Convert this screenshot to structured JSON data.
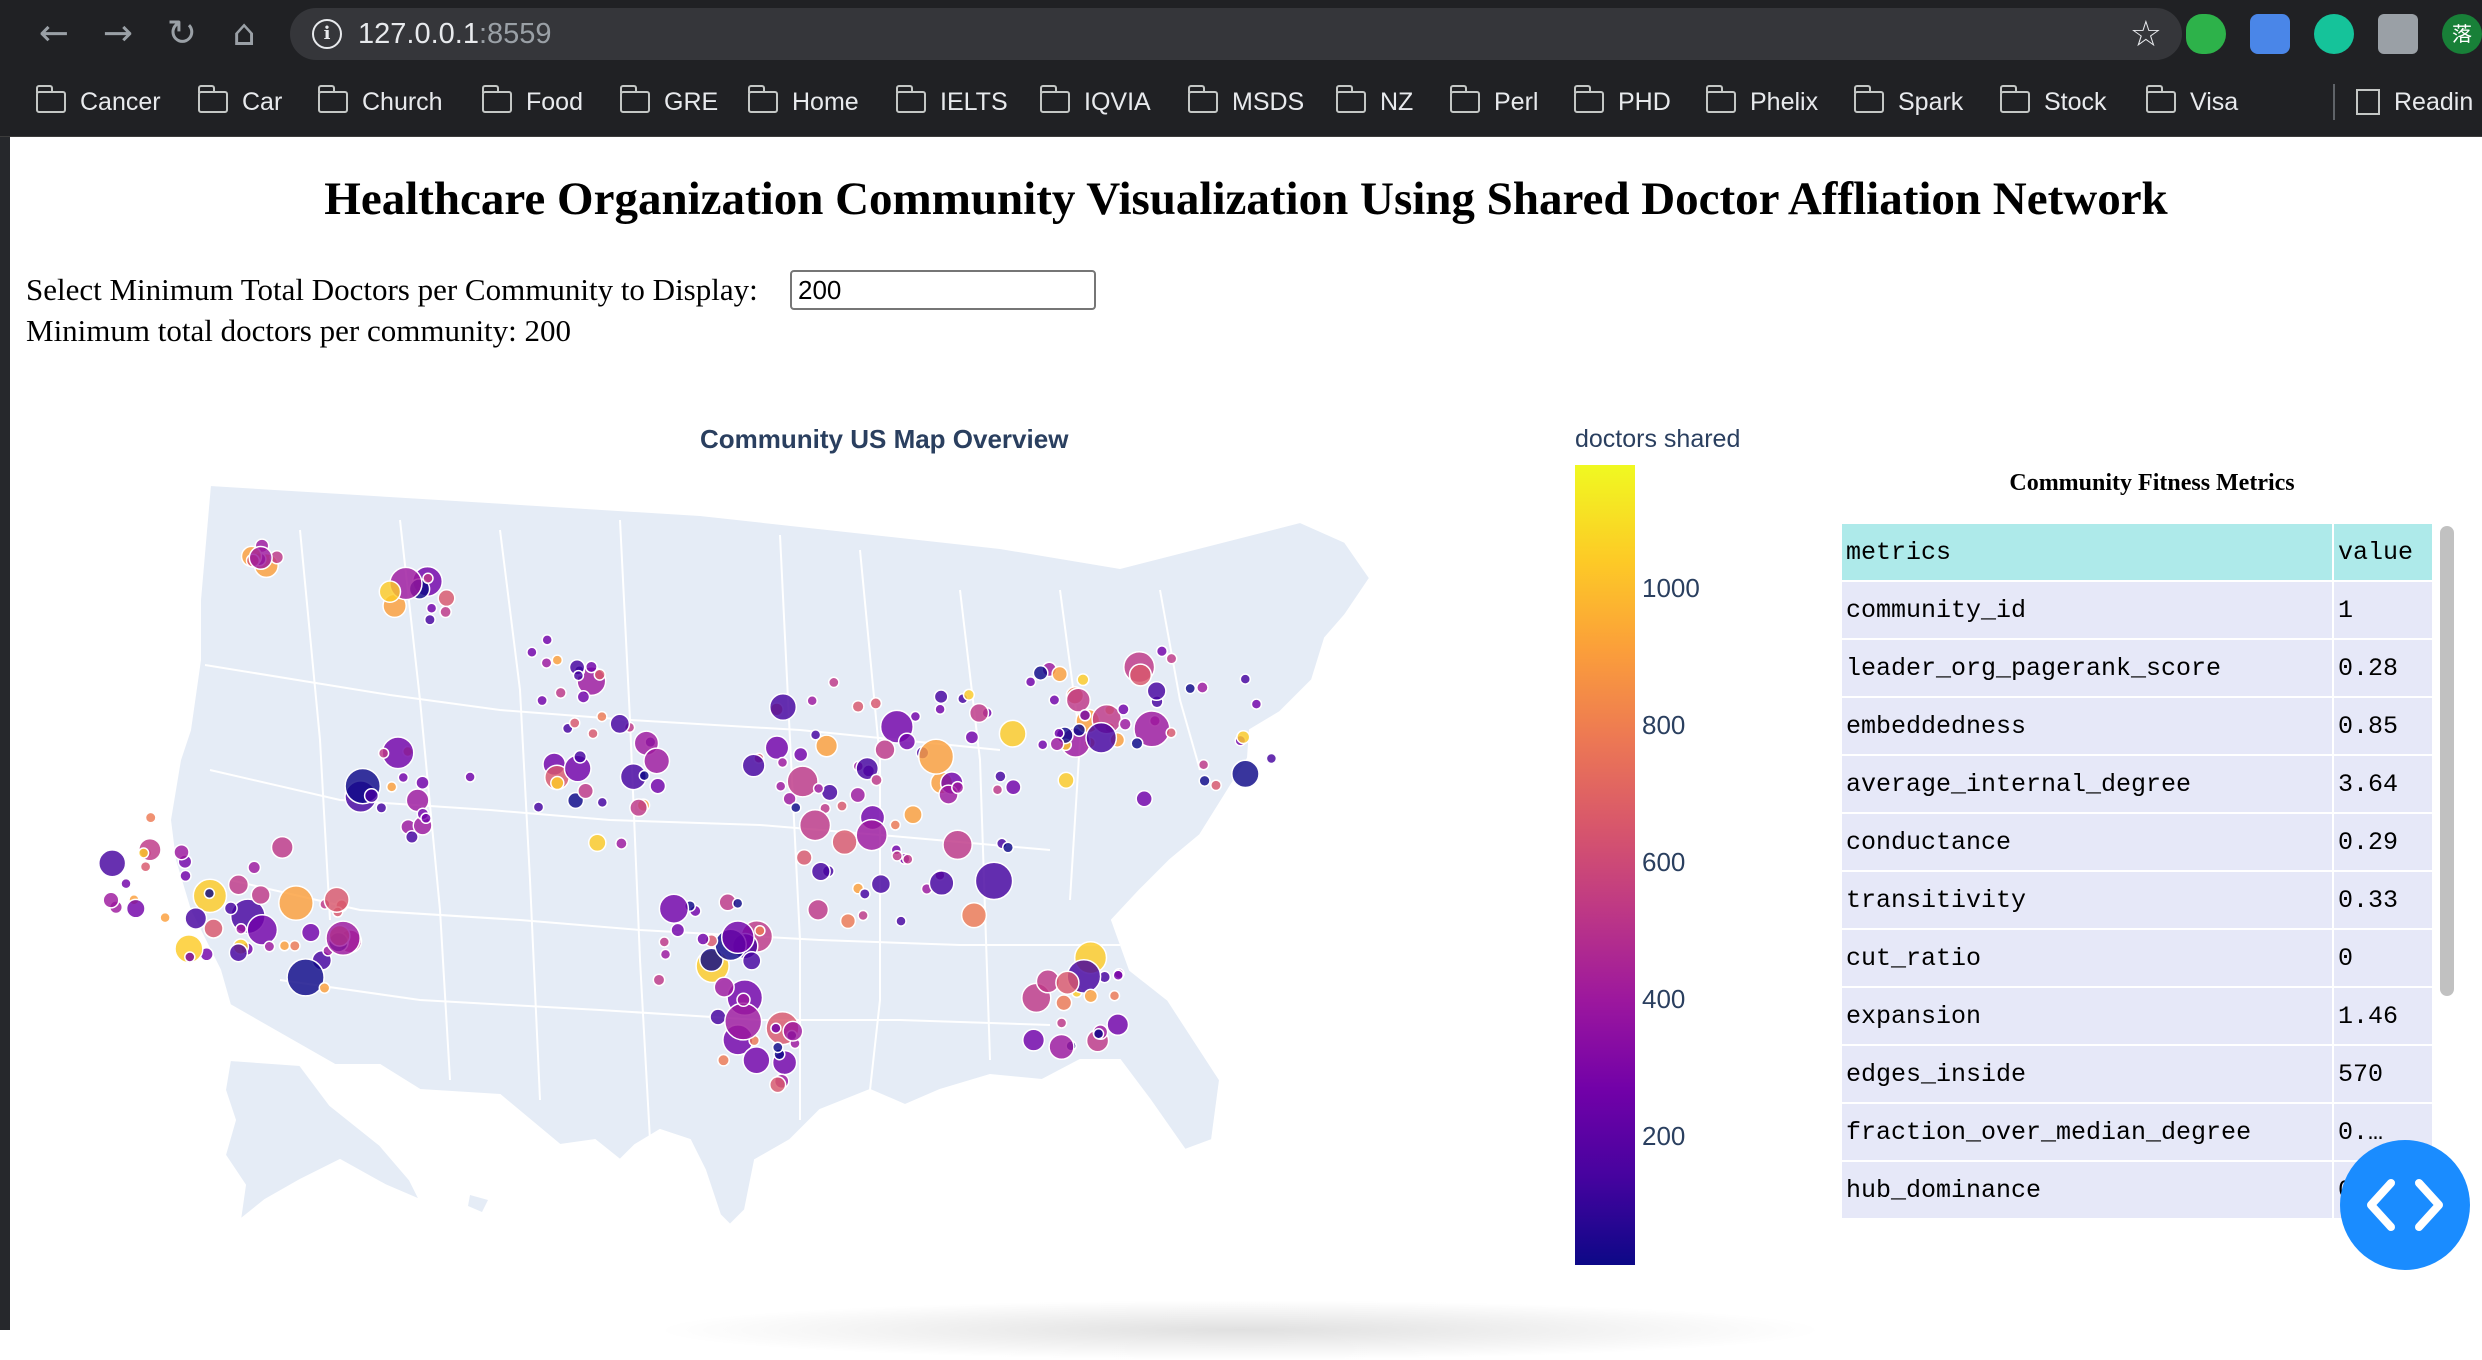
{
  "browser": {
    "url_host": "127.0.0.1",
    "url_port": ":8559",
    "bookmarks": [
      "Cancer",
      "Car",
      "Church",
      "Food",
      "GRE",
      "Home",
      "IELTS",
      "IQVIA",
      "MSDS",
      "NZ",
      "Perl",
      "PHD",
      "Phelix",
      "Spark",
      "Stock",
      "Visa"
    ],
    "reading_list": "Readin",
    "extensions": [
      "evernote-icon",
      "translate-icon",
      "grammarly-icon",
      "puzzle-extensions-icon",
      "profile-avatar"
    ],
    "profile_initial": "落"
  },
  "page": {
    "title": "Healthcare Organization Community Visualization Using Shared Doctor Affliation Network",
    "input_label": "Select Minimum Total Doctors per Community to Display:",
    "input_value": "200",
    "min_line": "Minimum total doctors per community: 200"
  },
  "map": {
    "title": "Community US Map Overview"
  },
  "colorbar": {
    "title": "doctors shared",
    "ticks": [
      "1000",
      "800",
      "600",
      "400",
      "200"
    ],
    "colorscale": [
      "#0d0887",
      "#46039f",
      "#7201a8",
      "#9c179e",
      "#bd3786",
      "#d8576b",
      "#ed7953",
      "#fb9f3a",
      "#fdca26",
      "#f0f921"
    ]
  },
  "table": {
    "title": "Community Fitness Metrics",
    "header": [
      "metrics",
      "value"
    ],
    "rows": [
      [
        "community_id",
        "1"
      ],
      [
        "leader_org_pagerank_score",
        "0.28"
      ],
      [
        "embeddedness",
        "0.85"
      ],
      [
        "average_internal_degree",
        "3.64"
      ],
      [
        "conductance",
        "0.29"
      ],
      [
        "transitivity",
        "0.33"
      ],
      [
        "cut_ratio",
        "0"
      ],
      [
        "expansion",
        "1.46"
      ],
      [
        "edges_inside",
        "570"
      ],
      [
        "fraction_over_median_degree",
        "0.…"
      ],
      [
        "hub_dominance",
        "0"
      ]
    ]
  }
}
